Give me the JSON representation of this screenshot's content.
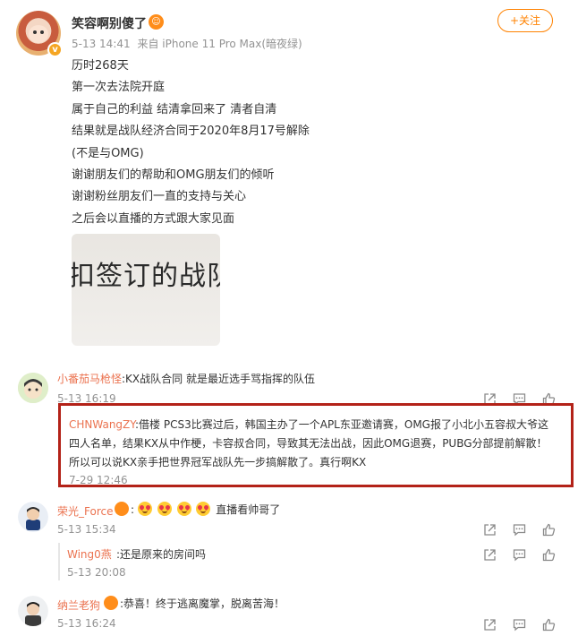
{
  "post": {
    "author": "笑容啊别傻了",
    "time": "5-13 14:41",
    "source": "来自 iPhone 11 Pro Max(暗夜绿)",
    "follow_label": "+关注",
    "lines": [
      "历时268天",
      "第一次去法院开庭",
      "属于自己的利益 结清拿回来了 清者自清",
      "结果就是战队经济合同于2020年8月17号解除",
      "(不是与OMG)",
      "谢谢朋友们的帮助和OMG朋友们的倾听",
      "谢谢粉丝朋友们一直的支持与关心",
      "之后会以直播的方式跟大家见面"
    ],
    "image_text": "扣签订的战队"
  },
  "comments": [
    {
      "name": "小番茄马枪怪",
      "text": ":KX战队合同 就是最近选手骂指挥的队伍",
      "time": "5-13 16:19"
    },
    {
      "name": "荣光_Force",
      "text": "直播看帅哥了",
      "time": "5-13 15:34"
    },
    {
      "name": "纳兰老狗",
      "text": ":恭喜！终于逃离魔掌，脱离苦海！",
      "time": "5-13 16:24"
    }
  ],
  "highlight_reply": {
    "name": "CHNWangZY",
    "line1": ":借楼 PCS3比赛过后，韩国主办了一个APL东亚邀请赛，OMG报了小北小五容叔大爷这",
    "line2": "四人名单，结果KX从中作梗，卡容叔合同，导致其无法出战，因此OMG退赛，PUBG分部提前解散！",
    "line3": "所以可以说KX亲手把世界冠军战队先一步搞解散了。真行啊KX",
    "time": "7-29 12:46"
  },
  "sub_reply": {
    "name": "Wing0燕",
    "text": ":还是原来的房间吗",
    "time": "5-13 20:08"
  },
  "colors": {
    "accent": "#ff8200",
    "name": "#eb7350",
    "highlight_border": "#b32218"
  },
  "icons": [
    "share-icon",
    "comment-icon",
    "like-icon"
  ]
}
